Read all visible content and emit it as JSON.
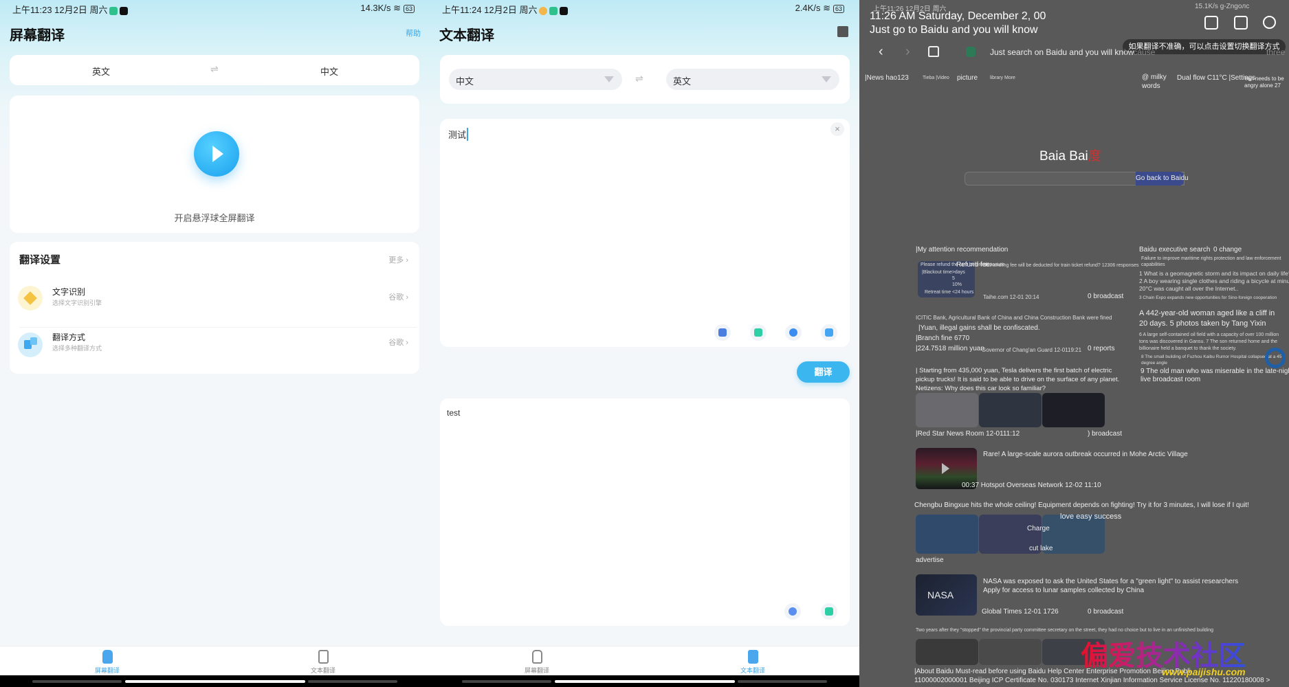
{
  "left": {
    "status": {
      "time": "上午11:23 12月2日 周六",
      "speed": "14.3K/s",
      "battery": "63"
    },
    "title": "屏幕翻译",
    "help": "帮助",
    "lang": {
      "source": "英文",
      "swap": "⇌",
      "target": "中文"
    },
    "float_label": "开启悬浮球全屏翻译",
    "settings": {
      "title": "翻译设置",
      "more": "更多 ›",
      "items": [
        {
          "title": "文字识别",
          "sub": "选择文字识别引擎",
          "value": "谷歌 ›"
        },
        {
          "title": "翻译方式",
          "sub": "选择多种翻译方式",
          "value": "谷歌 ›"
        }
      ]
    },
    "nav": [
      {
        "label": "屏幕翻译",
        "active": true
      },
      {
        "label": "文本翻译",
        "active": false
      }
    ]
  },
  "middle": {
    "status": {
      "time": "上午11:24 12月2日 周六",
      "speed": "2.4K/s",
      "battery": "63"
    },
    "title": "文本翻译",
    "lang": {
      "source": "中文",
      "swap": "⇌",
      "target": "英文"
    },
    "input": {
      "value": "测试",
      "clear": "×"
    },
    "translate_button": "翻译",
    "output": {
      "value": "test"
    },
    "nav": [
      {
        "label": "屏幕翻译",
        "active": false
      },
      {
        "label": "文本翻译",
        "active": true
      }
    ]
  },
  "right": {
    "status": {
      "time": "上午11:26 12月2日 周六",
      "speed": "15.1K/s g-Zngoлc"
    },
    "overlay": {
      "line1": "11:26 AM Saturday, December 2, 00",
      "line2": "Just go to Baidu and you will know"
    },
    "tooltip": "如果翻译不准确，可以点击设置切换翻译方式",
    "browser": {
      "back": "‹",
      "forward": "›",
      "search_text": "Just search on Baidu and you will know",
      "because": "because",
      "three": "three"
    },
    "links": [
      "|News hao123",
      "Tieba |Video",
      "picture",
      "library More",
      "@ milky",
      "words",
      "Dual flow C11°C |Settings",
      "Yan needs to be",
      "angry alone 27"
    ],
    "logo": "Baia Bai",
    "logo_suffix": "度",
    "search_button": "Go back to Baidu",
    "feed": {
      "heading": "|My attention recommendation",
      "thumb_lines": [
        "Please refund the fare before departure",
        "|Blackout time>days",
        "5",
        "10%",
        "Retreat time <24 hours"
      ],
      "refund": "Refund fee",
      "item1_title": "No handling fee will be deducted for train ticket refund? 12306 responses",
      "item1_source": "Taihe.com 12-01 20:14",
      "item1_count": "0 broadcast",
      "item2_lines": [
        "ICITIC Bank, Agricultural Bank of China and China Construction Bank were fined",
        "|Yuan, illegal gains shall be confiscated.",
        "|Branch fine 6770",
        "|224.7518 million yuan"
      ],
      "item2_source": "Governor of Chang'an Guard 12-0119:21",
      "item2_count": "0 reports",
      "item3_lines": [
        "| Starting from 435,000 yuan, Tesla delivers the first batch of electric",
        "pickup trucks! It is said to be able to drive on the surface of any planet.",
        "Netizens: Why does this car look so familiar?"
      ],
      "item3_source": "|Red Star News Room 12-0111:12",
      "item3_count": ") broadcast",
      "item4_title": "Rare! A large-scale aurora outbreak occurred in Mohe Arctic Village",
      "item4_source": "00:37 Hotspot Overseas Network 12-02 11:10",
      "item5_title": "Chengbu Bingxue hits the whole ceiling! Equipment depends on fighting! Try it for 3 minutes, I will lose if I quit!",
      "item5_overlay": [
        "love easy success",
        "Charge",
        "cut lake"
      ],
      "item5_ad": "advertise",
      "item6_thumb": "NASA",
      "item6_lines": [
        "NASA was exposed to ask the United States for a \"green light\" to assist researchers",
        "Apply for access to lunar samples collected by China"
      ],
      "item6_source": "Global Times 12-01 1726",
      "item6_count": "0 broadcast",
      "item7_title": "Two years after they \"stopped\" the provincial party committee secretary on the street, they had no choice but to live in an unfinished building",
      "footer": [
        "|About Baidu Must-read before using Baidu Help Center Enterprise Promotion Beijing Publi",
        "11000002000001 Beijing ICP Certificate No. 030173 Internet Xinjian Information Service License No. 11220180008 >"
      ]
    },
    "hot": {
      "heading": "Baidu executive search",
      "change": "0 change",
      "lines": [
        "Failure to improve maritime rights protection and law enforcement",
        "capabilities",
        "1 What is a geomagnetic storm and its impact on daily life?",
        "2 A boy wearing single clothes and riding a bicycle at minus",
        "20°C was caught all over the Internet..",
        "3 Chain Expo expands new opportunities for Sino-foreign cooperation",
        "A 442-year-old woman aged like a cliff in",
        "20 days. 5 photos taken by Tang Yixin",
        "6 A large self-contained oil field with a capacity of over 100 million",
        "tons was discovered in Gansu. 7 The son returned home and the",
        "billionaire held a banquet to thank the society.",
        "8 The small building of Fuzhou Kaibu Rumor Hospital collapsed at a 45",
        "degree angle",
        "9 The old man who was miserable in the late-night",
        "live broadcast room"
      ]
    },
    "watermark": {
      "text": "偏爱技术社区",
      "url": "www.paijishu.com"
    }
  }
}
